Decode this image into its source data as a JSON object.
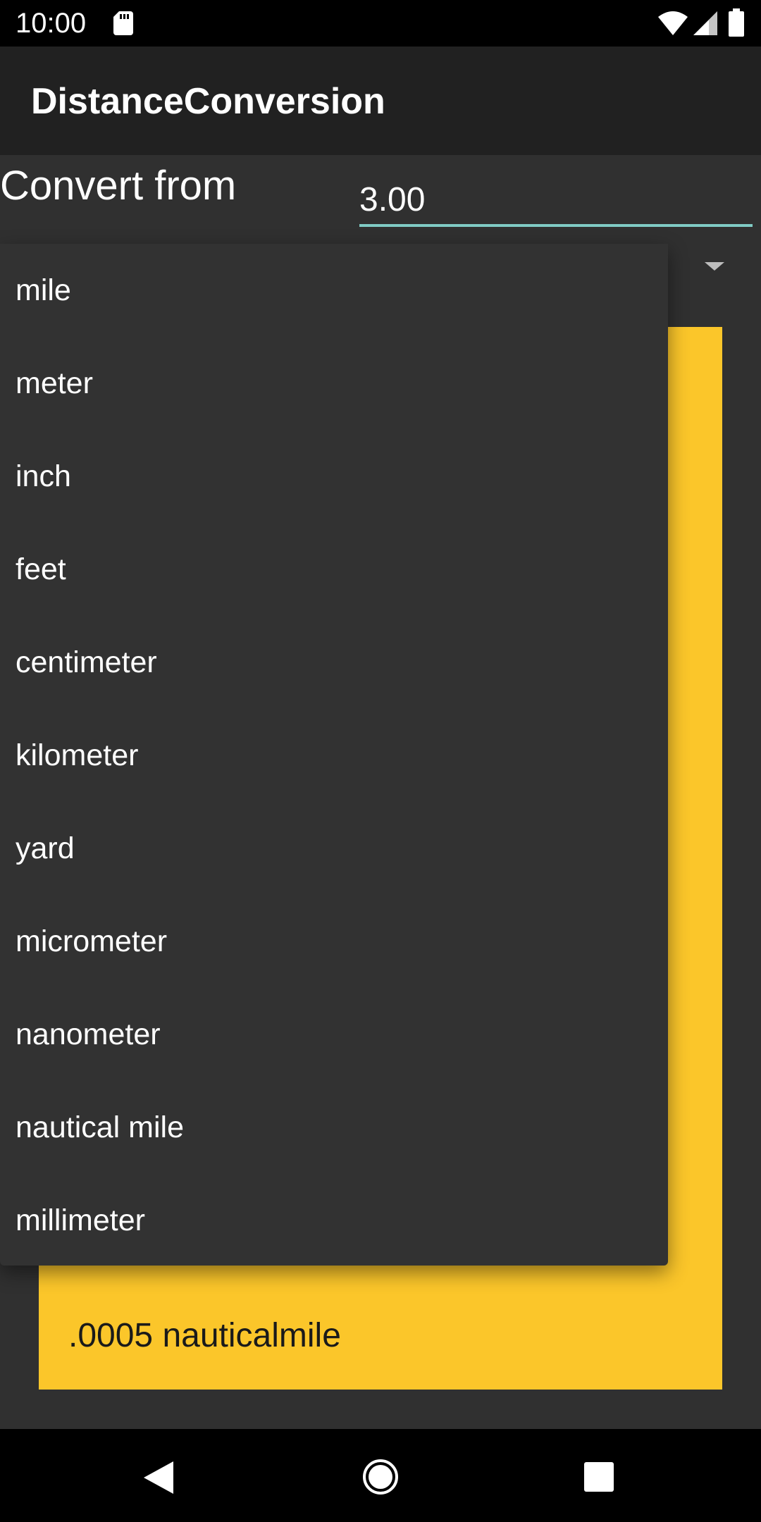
{
  "status_bar": {
    "time": "10:00",
    "icons": [
      "sd-card-icon",
      "wifi-icon",
      "signal-icon",
      "battery-icon"
    ]
  },
  "app_bar": {
    "title": "DistanceConversion"
  },
  "form": {
    "convert_from_label": "Convert from",
    "value": "3.00"
  },
  "dropdown": {
    "options": [
      "mile",
      "meter",
      "inch",
      "feet",
      "centimeter",
      "kilometer",
      "yard",
      "micrometer",
      "nanometer",
      "nautical mile",
      "millimeter"
    ]
  },
  "result": {
    "text": ".0005 nauticalmile"
  },
  "nav_bar": {
    "icons": [
      "back-icon",
      "home-icon",
      "recents-icon"
    ]
  },
  "colors": {
    "background": "#303030",
    "app_bar": "#212121",
    "accent_underline": "#80cbc4",
    "result_card": "#fbc62a",
    "dropdown": "#323232"
  }
}
